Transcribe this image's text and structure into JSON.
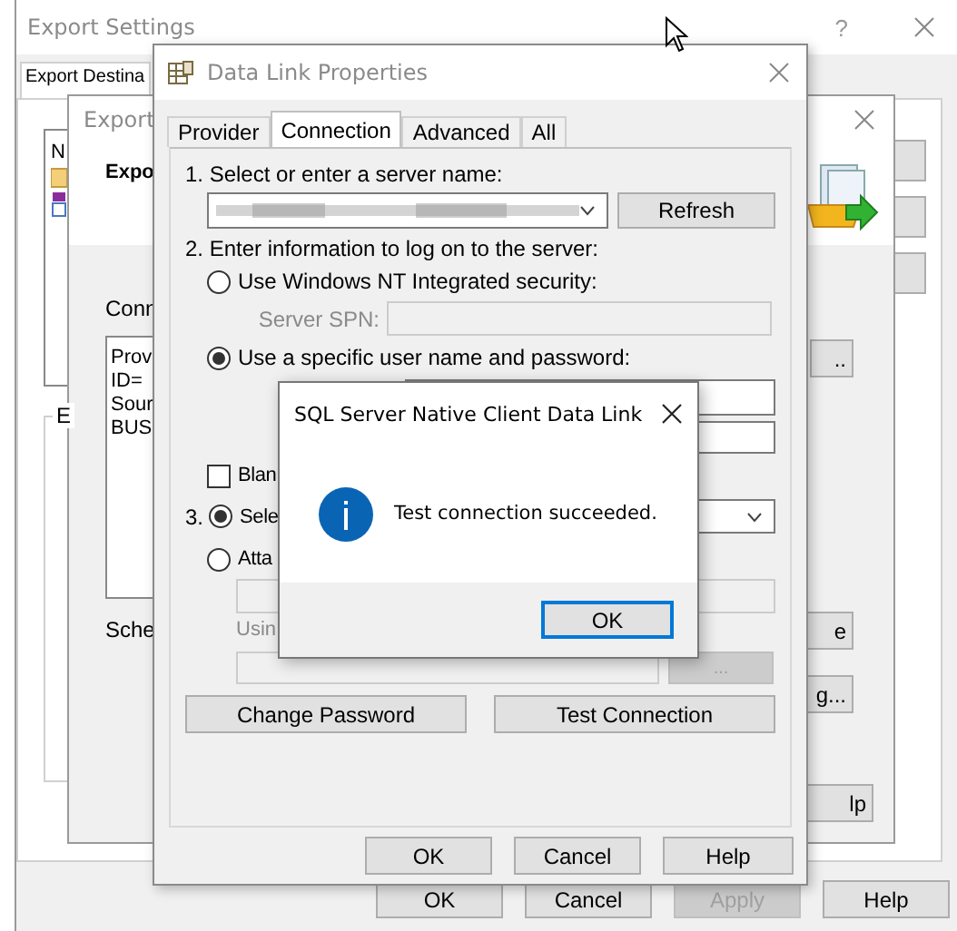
{
  "export_settings": {
    "title": "Export Settings",
    "help_glyph": "?",
    "tab": "Export Destina",
    "list_item": "N",
    "buttons": [
      {
        "label": "OK",
        "disabled": false
      },
      {
        "label": "Cancel",
        "disabled": false
      },
      {
        "label": "Apply",
        "disabled": true
      },
      {
        "label": "Help",
        "disabled": false
      }
    ]
  },
  "export_window": {
    "title": "Export",
    "heading": "Expo",
    "connection_label": "Conn",
    "connection_lines": [
      "Prov",
      "ID=",
      "Sour",
      "BUS"
    ],
    "group_label": "E",
    "schema_label": "Sche",
    "side_buttons": [
      "..",
      "e",
      "g...",
      "lp"
    ]
  },
  "data_link": {
    "title": "Data Link Properties",
    "tabs": [
      {
        "label": "Provider",
        "selected": false
      },
      {
        "label": "Connection",
        "selected": true
      },
      {
        "label": "Advanced",
        "selected": false
      },
      {
        "label": "All",
        "selected": false
      }
    ],
    "step1": "1. Select or enter a server name:",
    "refresh": "Refresh",
    "step2": "2. Enter information to log on to the server:",
    "logon_options": [
      {
        "label": "Use Windows NT Integrated security:",
        "selected": false
      },
      {
        "label": "Use a specific user name and password:",
        "selected": true
      }
    ],
    "spn_label": "Server SPN:",
    "blank_password": {
      "label": "Blan",
      "checked": false
    },
    "step3_number": "3.",
    "db_options": [
      {
        "label": "Sele",
        "selected": true
      },
      {
        "label": "Atta",
        "selected": false
      }
    ],
    "using_label": "Usin",
    "browse_button": "...",
    "change_password": "Change Password",
    "test_connection": "Test Connection",
    "buttons": [
      "OK",
      "Cancel",
      "Help"
    ]
  },
  "message_box": {
    "title": "SQL Server Native Client Data Link",
    "message": "Test connection succeeded.",
    "ok": "OK"
  }
}
